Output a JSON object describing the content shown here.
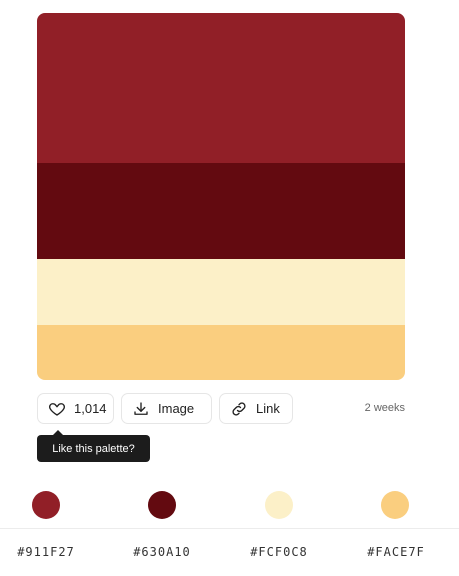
{
  "palette": {
    "colors": [
      {
        "hex": "#911F27",
        "label": "#911F27"
      },
      {
        "hex": "#630A10",
        "label": "#630A10"
      },
      {
        "hex": "#FCF0C8",
        "label": "#FCF0C8"
      },
      {
        "hex": "#FACE7F",
        "label": "#FACE7F"
      }
    ]
  },
  "actions": {
    "like_count": "1,014",
    "image_label": "Image",
    "link_label": "Link",
    "time_ago": "2 weeks"
  },
  "tooltip": {
    "text": "Like this palette?"
  },
  "icons": {
    "like": "heart-icon",
    "image": "download-icon",
    "link": "link-icon"
  }
}
